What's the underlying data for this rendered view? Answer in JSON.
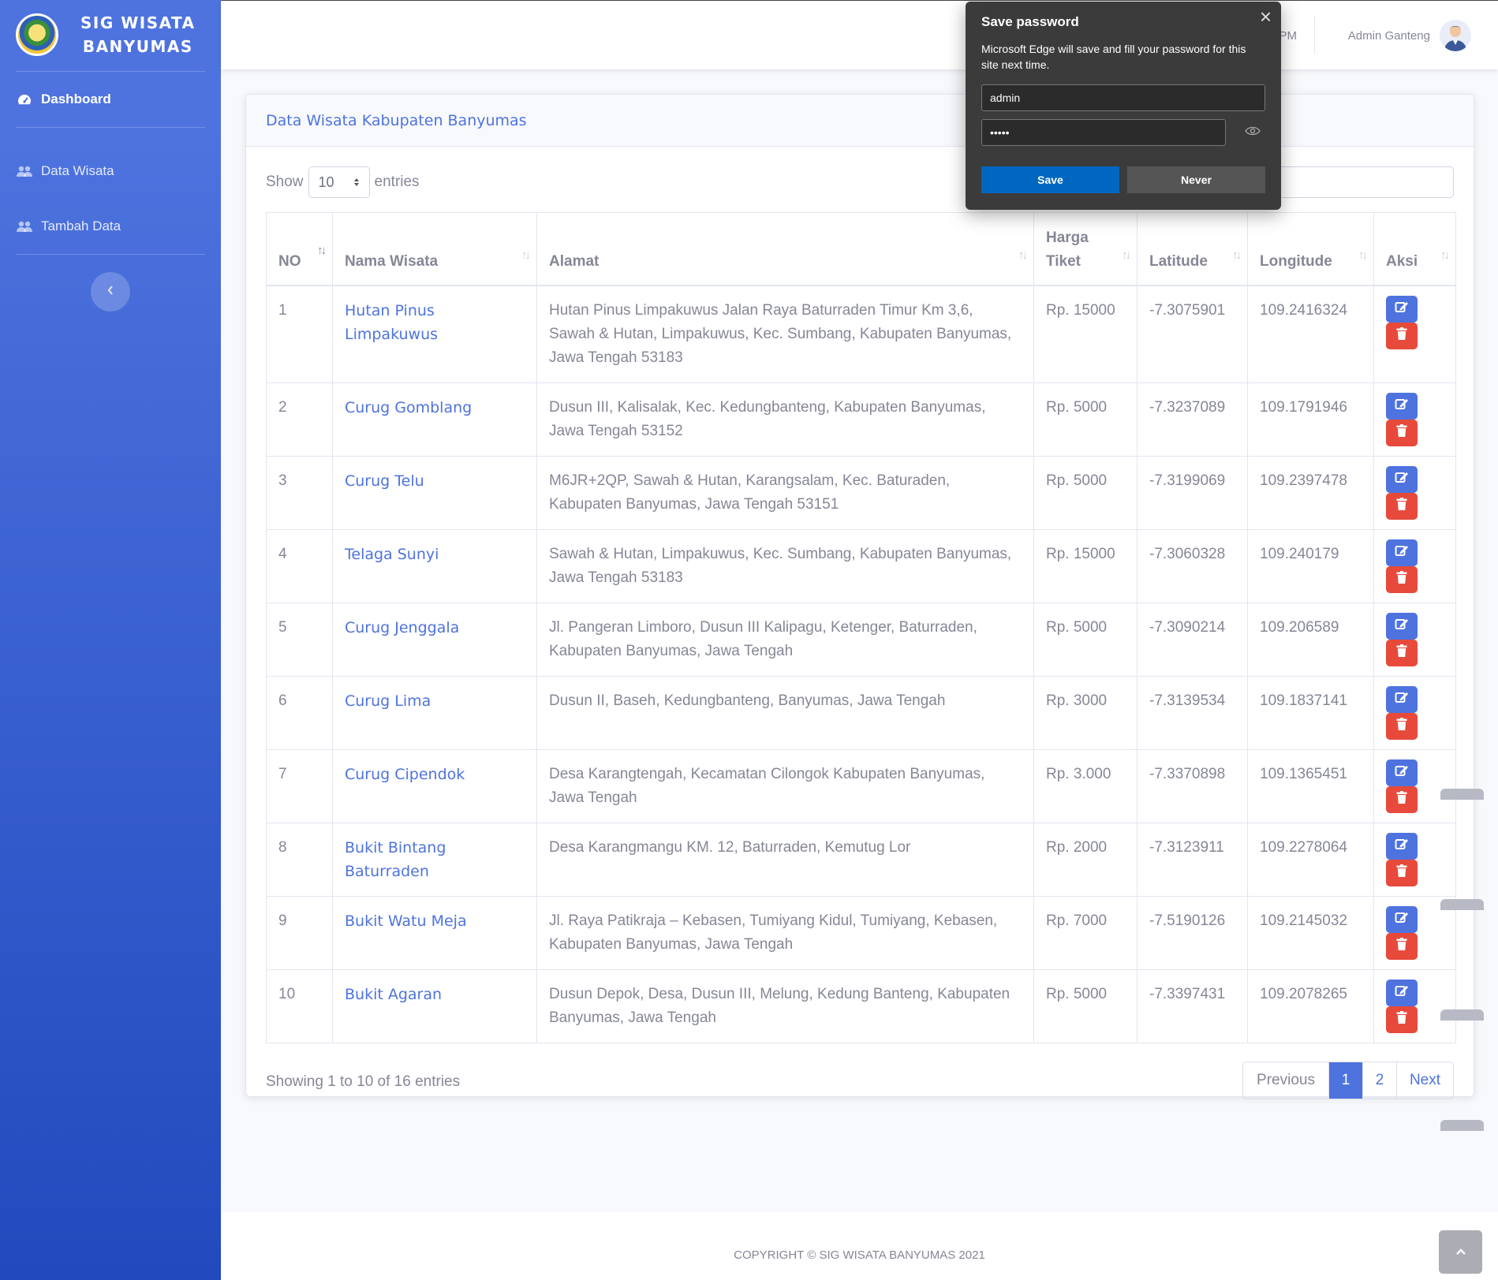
{
  "sidebar": {
    "brand_line1": "SIG WISATA",
    "brand_line2": "BANYUMAS",
    "items": [
      {
        "label": "Dashboard",
        "icon": "tachometer-icon"
      },
      {
        "label": "Data Wisata",
        "icon": "users-icon"
      },
      {
        "label": "Tambah Data",
        "icon": "users-icon"
      }
    ],
    "toggle_icon": "chevron-left-icon"
  },
  "topbar": {
    "partial_text": "PM",
    "user_name": "Admin Ganteng"
  },
  "card": {
    "title": "Data Wisata Kabupaten Banyumas",
    "length_prefix": "Show",
    "length_value": "10",
    "length_suffix": "entries",
    "columns": [
      "NO",
      "Nama Wisata",
      "Alamat",
      "Harga Tiket",
      "Latitude",
      "Longitude",
      "Aksi"
    ],
    "rows": [
      {
        "no": "1",
        "nama": "Hutan Pinus Limpakuwus",
        "alamat": "Hutan Pinus Limpakuwus Jalan Raya Baturraden Timur Km 3,6, Sawah & Hutan, Limpakuwus, Kec. Sumbang, Kabupaten Banyumas, Jawa Tengah 53183",
        "harga": "Rp. 15000",
        "lat": "-7.3075901",
        "lng": "109.2416324"
      },
      {
        "no": "2",
        "nama": "Curug Gomblang",
        "alamat": "Dusun III, Kalisalak, Kec. Kedungbanteng, Kabupaten Banyumas, Jawa Tengah 53152",
        "harga": "Rp. 5000",
        "lat": "-7.3237089",
        "lng": "109.1791946"
      },
      {
        "no": "3",
        "nama": "Curug Telu",
        "alamat": "M6JR+2QP, Sawah & Hutan, Karangsalam, Kec. Baturaden, Kabupaten Banyumas, Jawa Tengah 53151",
        "harga": "Rp. 5000",
        "lat": "-7.3199069",
        "lng": "109.2397478"
      },
      {
        "no": "4",
        "nama": "Telaga Sunyi",
        "alamat": "Sawah & Hutan, Limpakuwus, Kec. Sumbang, Kabupaten Banyumas, Jawa Tengah 53183",
        "harga": "Rp. 15000",
        "lat": "-7.3060328",
        "lng": "109.240179"
      },
      {
        "no": "5",
        "nama": "Curug Jenggala",
        "alamat": "Jl. Pangeran Limboro, Dusun III Kalipagu, Ketenger, Baturraden, Kabupaten Banyumas, Jawa Tengah",
        "harga": "Rp. 5000",
        "lat": "-7.3090214",
        "lng": "109.206589"
      },
      {
        "no": "6",
        "nama": "Curug Lima",
        "alamat": "Dusun II, Baseh, Kedungbanteng, Banyumas, Jawa Tengah",
        "harga": "Rp. 3000",
        "lat": "-7.3139534",
        "lng": "109.1837141"
      },
      {
        "no": "7",
        "nama": "Curug Cipendok",
        "alamat": "Desa Karangtengah, Kecamatan Cilongok Kabupaten Banyumas, Jawa Tengah",
        "harga": "Rp. 3.000",
        "lat": "-7.3370898",
        "lng": "109.1365451"
      },
      {
        "no": "8",
        "nama": "Bukit Bintang Baturraden",
        "alamat": "Desa Karangmangu KM. 12, Baturraden, Kemutug Lor",
        "harga": "Rp. 2000",
        "lat": "-7.3123911",
        "lng": "109.2278064"
      },
      {
        "no": "9",
        "nama": "Bukit Watu Meja",
        "alamat": "Jl. Raya Patikraja – Kebasen, Tumiyang Kidul, Tumiyang, Kebasen, Kabupaten Banyumas, Jawa Tengah",
        "harga": "Rp. 7000",
        "lat": "-7.5190126",
        "lng": "109.2145032"
      },
      {
        "no": "10",
        "nama": "Bukit Agaran",
        "alamat": "Dusun Depok, Desa, Dusun III, Melung, Kedung Banteng, Kabupaten Banyumas, Jawa Tengah",
        "harga": "Rp. 5000",
        "lat": "-7.3397431",
        "lng": "109.2078265"
      }
    ],
    "info": "Showing 1 to 10 of 16 entries",
    "pager": {
      "prev": "Previous",
      "p1": "1",
      "p2": "2",
      "next": "Next"
    }
  },
  "footer": "COPYRIGHT © SIG WISATA BANYUMAS 2021",
  "popup": {
    "title": "Save password",
    "message": "Microsoft Edge will save and fill your password for this site next time.",
    "username": "admin",
    "password_mask": "•••••",
    "save_label": "Save",
    "never_label": "Never"
  },
  "colors": {
    "primary": "#4e73df",
    "danger": "#e74a3b",
    "text": "#858796"
  }
}
